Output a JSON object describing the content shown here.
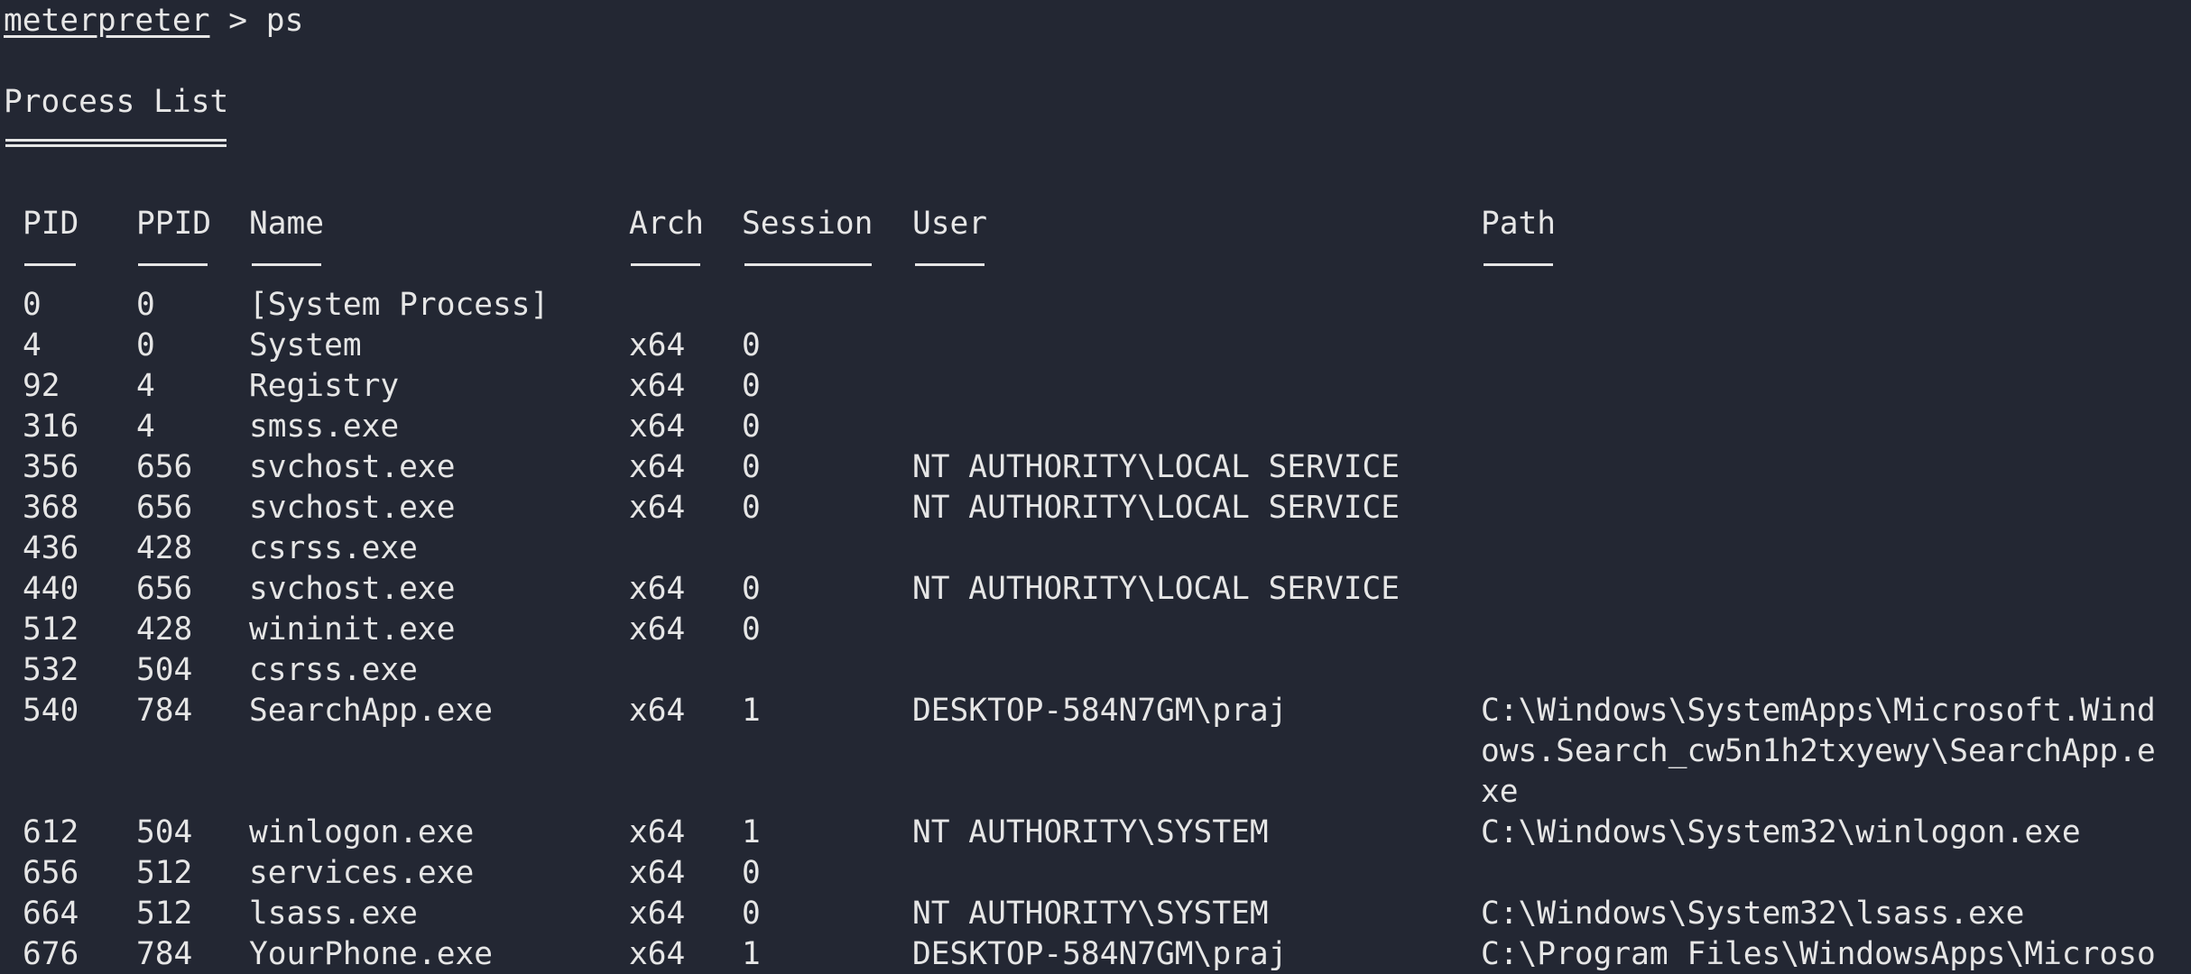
{
  "prompt": {
    "name": "meterpreter",
    "separator": " > ",
    "command": "ps"
  },
  "title": "Process List",
  "columns": {
    "pid": "PID",
    "ppid": "PPID",
    "name": "Name",
    "arch": "Arch",
    "session": "Session",
    "user": "User",
    "path": "Path"
  },
  "rows": [
    {
      "pid": "0",
      "ppid": "0",
      "name": "[System Process]",
      "arch": "",
      "session": "",
      "user": "",
      "path": []
    },
    {
      "pid": "4",
      "ppid": "0",
      "name": "System",
      "arch": "x64",
      "session": "0",
      "user": "",
      "path": []
    },
    {
      "pid": "92",
      "ppid": "4",
      "name": "Registry",
      "arch": "x64",
      "session": "0",
      "user": "",
      "path": []
    },
    {
      "pid": "316",
      "ppid": "4",
      "name": "smss.exe",
      "arch": "x64",
      "session": "0",
      "user": "",
      "path": []
    },
    {
      "pid": "356",
      "ppid": "656",
      "name": "svchost.exe",
      "arch": "x64",
      "session": "0",
      "user": "NT AUTHORITY\\LOCAL SERVICE",
      "path": []
    },
    {
      "pid": "368",
      "ppid": "656",
      "name": "svchost.exe",
      "arch": "x64",
      "session": "0",
      "user": "NT AUTHORITY\\LOCAL SERVICE",
      "path": []
    },
    {
      "pid": "436",
      "ppid": "428",
      "name": "csrss.exe",
      "arch": "",
      "session": "",
      "user": "",
      "path": []
    },
    {
      "pid": "440",
      "ppid": "656",
      "name": "svchost.exe",
      "arch": "x64",
      "session": "0",
      "user": "NT AUTHORITY\\LOCAL SERVICE",
      "path": []
    },
    {
      "pid": "512",
      "ppid": "428",
      "name": "wininit.exe",
      "arch": "x64",
      "session": "0",
      "user": "",
      "path": []
    },
    {
      "pid": "532",
      "ppid": "504",
      "name": "csrss.exe",
      "arch": "",
      "session": "",
      "user": "",
      "path": []
    },
    {
      "pid": "540",
      "ppid": "784",
      "name": "SearchApp.exe",
      "arch": "x64",
      "session": "1",
      "user": "DESKTOP-584N7GM\\praj",
      "path": [
        "C:\\Windows\\SystemApps\\Microsoft.Wind",
        "ows.Search_cw5n1h2txyewy\\SearchApp.e",
        "xe"
      ]
    },
    {
      "pid": "612",
      "ppid": "504",
      "name": "winlogon.exe",
      "arch": "x64",
      "session": "1",
      "user": "NT AUTHORITY\\SYSTEM",
      "path": [
        "C:\\Windows\\System32\\winlogon.exe"
      ]
    },
    {
      "pid": "656",
      "ppid": "512",
      "name": "services.exe",
      "arch": "x64",
      "session": "0",
      "user": "",
      "path": []
    },
    {
      "pid": "664",
      "ppid": "512",
      "name": "lsass.exe",
      "arch": "x64",
      "session": "0",
      "user": "NT AUTHORITY\\SYSTEM",
      "path": [
        "C:\\Windows\\System32\\lsass.exe"
      ]
    },
    {
      "pid": "676",
      "ppid": "784",
      "name": "YourPhone.exe",
      "arch": "x64",
      "session": "1",
      "user": "DESKTOP-584N7GM\\praj",
      "path": [
        "C:\\Program Files\\WindowsApps\\Microso"
      ]
    }
  ]
}
